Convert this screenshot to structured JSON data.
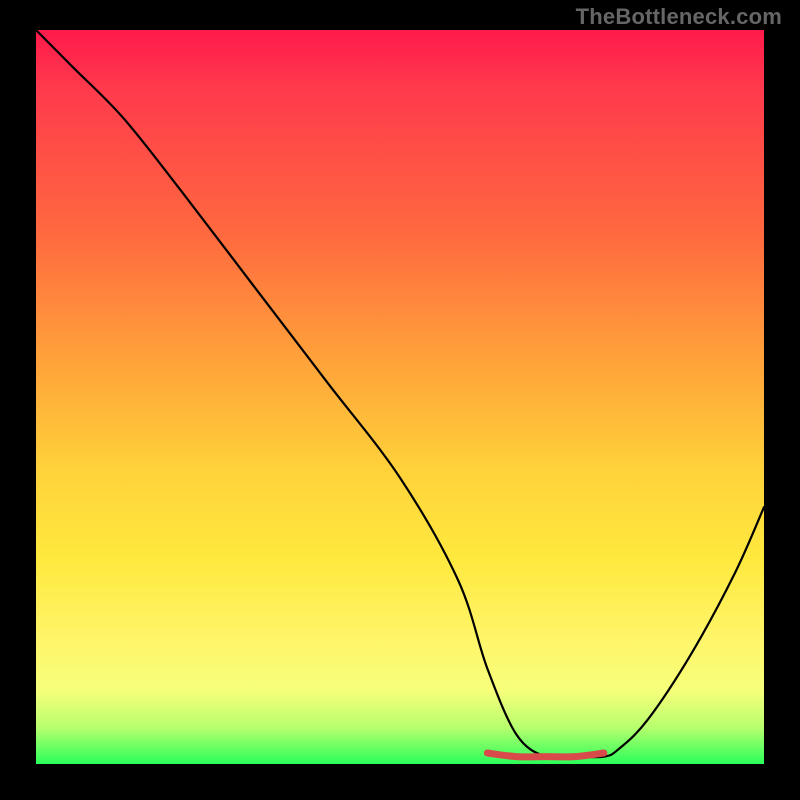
{
  "watermark": "TheBottleneck.com",
  "chart_data": {
    "type": "line",
    "title": "",
    "xlabel": "",
    "ylabel": "",
    "xlim": [
      0,
      100
    ],
    "ylim": [
      0,
      100
    ],
    "series": [
      {
        "name": "black-curve",
        "color": "#000000",
        "x": [
          0,
          5,
          12,
          20,
          30,
          40,
          50,
          58,
          62,
          66,
          70,
          74,
          78,
          80,
          84,
          90,
          96,
          100
        ],
        "values": [
          100,
          95,
          88,
          78,
          65,
          52,
          39,
          25,
          13,
          4,
          1,
          1,
          1,
          2,
          6,
          15,
          26,
          35
        ]
      },
      {
        "name": "red-flat-segment",
        "color": "#d94a4a",
        "x": [
          62,
          66,
          70,
          74,
          78
        ],
        "values": [
          1.5,
          1.0,
          1.0,
          1.0,
          1.5
        ]
      }
    ],
    "annotations": []
  }
}
